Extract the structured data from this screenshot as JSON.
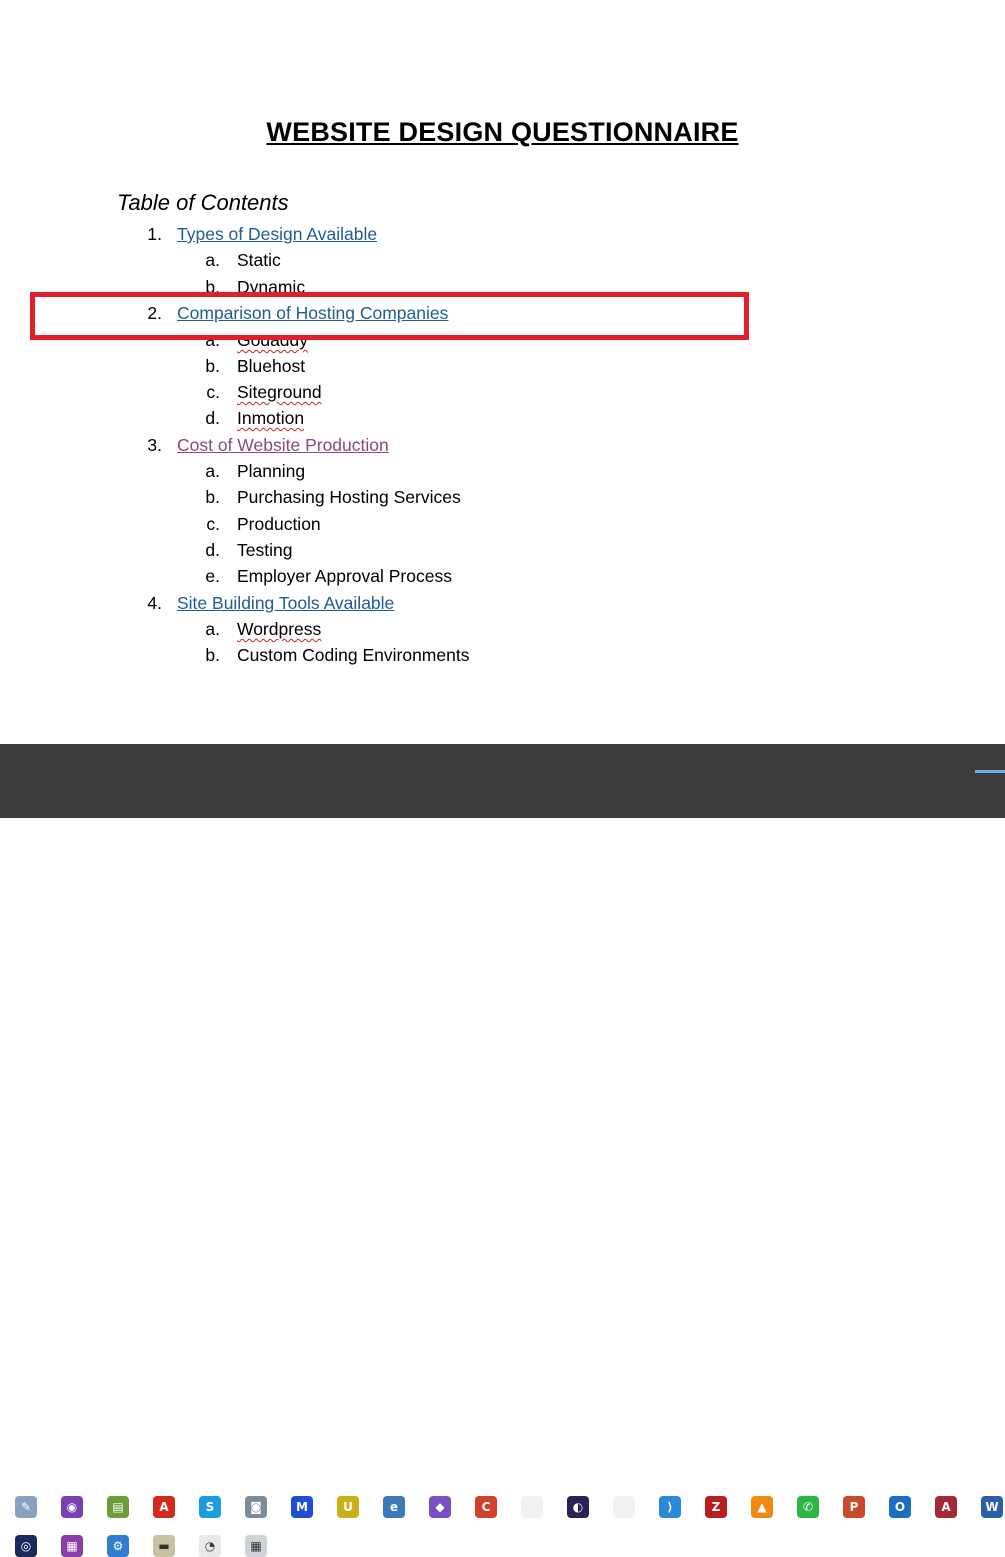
{
  "document": {
    "title": "WEBSITE DESIGN QUESTIONNAIRE",
    "toc_heading": "Table of Contents",
    "sections": [
      {
        "num": "1.",
        "label": "Types of Design Available",
        "items": [
          {
            "letter": "a.",
            "label": "Static"
          },
          {
            "letter": "b.",
            "label": "Dynamic"
          }
        ]
      },
      {
        "num": "2.",
        "label": "Comparison of Hosting Companies",
        "items": [
          {
            "letter": "a.",
            "label": "Godaddy"
          },
          {
            "letter": "b.",
            "label": "Bluehost"
          },
          {
            "letter": "c.",
            "label": "Siteground"
          },
          {
            "letter": "d.",
            "label": "Inmotion"
          }
        ]
      },
      {
        "num": "3.",
        "label": "Cost of Website Production",
        "items": [
          {
            "letter": "a.",
            "label": "Planning"
          },
          {
            "letter": "b.",
            "label": "Purchasing Hosting Services"
          },
          {
            "letter": "c.",
            "label": "Production"
          },
          {
            "letter": "d.",
            "label": "Testing"
          },
          {
            "letter": "e.",
            "label": "Employer Approval Process"
          }
        ]
      },
      {
        "num": "4.",
        "label": "Site Building Tools Available",
        "items": [
          {
            "letter": "a.",
            "label": "Wordpress"
          },
          {
            "letter": "b.",
            "label": "Custom Coding Environments"
          }
        ]
      }
    ]
  },
  "colors": {
    "link": "#1f5c91",
    "visited_link": "#8a4a7a",
    "highlight": "#e0202a",
    "taskbar": "#3c3c3c"
  },
  "taskbar": {
    "row1": [
      {
        "icon": "paint-icon",
        "color": "#8aa0c0",
        "glyph": "✎"
      },
      {
        "icon": "tor-browser-icon",
        "color": "#7a3fb0",
        "glyph": "◉"
      },
      {
        "icon": "notepad-chart-icon",
        "color": "#6b9e3a",
        "glyph": "▤"
      },
      {
        "icon": "acrobat-icon",
        "color": "#d32a1e",
        "glyph": "A"
      },
      {
        "icon": "skype-icon",
        "color": "#1b9be0",
        "glyph": "S"
      },
      {
        "icon": "camera-icon",
        "color": "#7d8a99",
        "glyph": "◙"
      },
      {
        "icon": "malwarebytes-icon",
        "color": "#1f4fd1",
        "glyph": "M"
      },
      {
        "icon": "ultraedit-icon",
        "color": "#c9b018",
        "glyph": "U"
      },
      {
        "icon": "browser-globe-icon",
        "color": "#3a7ab8",
        "glyph": "e"
      },
      {
        "icon": "visual-studio-icon",
        "color": "#7b4fc4",
        "glyph": "◆"
      },
      {
        "icon": "ccleaner-icon",
        "color": "#d0402a",
        "glyph": "C"
      },
      {
        "icon": "blank-file-icon",
        "color": "#f2f2f2",
        "glyph": ""
      },
      {
        "icon": "eclipse-icon",
        "color": "#2c2255",
        "glyph": "◐"
      },
      {
        "icon": "blank-file-icon-2",
        "color": "#f2f2f2",
        "glyph": ""
      },
      {
        "icon": "vscode-icon",
        "color": "#2a8ad8",
        "glyph": "⟩"
      },
      {
        "icon": "filezilla-icon",
        "color": "#b81e1e",
        "glyph": "Z"
      },
      {
        "icon": "vlc-icon",
        "color": "#f08a10",
        "glyph": "▲"
      },
      {
        "icon": "whatsapp-icon",
        "color": "#2bb741",
        "glyph": "✆"
      },
      {
        "icon": "powerpoint-icon",
        "color": "#c94a2a",
        "glyph": "P"
      },
      {
        "icon": "outlook-icon",
        "color": "#1a6fc0",
        "glyph": "O"
      },
      {
        "icon": "access-icon",
        "color": "#a52a36",
        "glyph": "A"
      },
      {
        "icon": "word-icon",
        "color": "#2b5fad",
        "glyph": "W"
      }
    ],
    "row2": [
      {
        "icon": "photoshop-icon",
        "color": "#1a2a5a",
        "glyph": "◎"
      },
      {
        "icon": "winrar-icon",
        "color": "#8a3fa8",
        "glyph": "▦"
      },
      {
        "icon": "network-icon",
        "color": "#2f7fd0",
        "glyph": "⚙"
      },
      {
        "icon": "scanner-icon",
        "color": "#c9c2a0",
        "glyph": "▬"
      },
      {
        "icon": "clock-icon",
        "color": "#e9e9e9",
        "glyph": "◔"
      },
      {
        "icon": "calculator-icon",
        "color": "#cfd3d8",
        "glyph": "▦"
      }
    ]
  }
}
